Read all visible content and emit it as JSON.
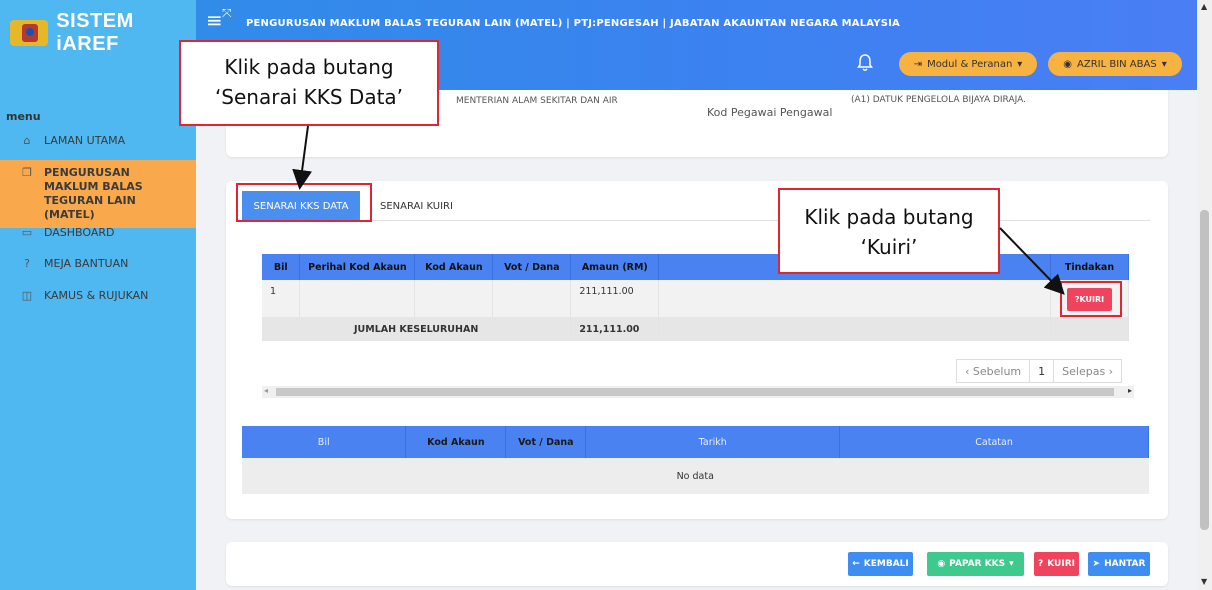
{
  "header": {
    "brand": "SISTEM iAREF",
    "page_heading": "PENGURUSAN MAKLUM BALAS TEGURAN LAIN (MATEL) | PTJ:PENGESAH | JABATAN AKAUNTAN NEGARA MALAYSIA",
    "modul_label": "Modul & Peranan",
    "user_label": "AZRIL BIN ABAS"
  },
  "sidebar": {
    "heading": "menu",
    "items": [
      {
        "label": "LAMAN UTAMA"
      },
      {
        "label": "PENGURUSAN MAKLUM BALAS TEGURAN LAIN (MATEL)"
      },
      {
        "label": "DASHBOARD"
      },
      {
        "label": "MEJA BANTUAN"
      },
      {
        "label": "KAMUS & RUJUKAN"
      }
    ]
  },
  "info": {
    "kementerian": "MENTERIAN ALAM SEKITAR DAN AIR",
    "kod_pegawai_label": "Kod Pegawai Pengawal",
    "kod_pegawai_value": "(A1) DATUK PENGELOLA BIJAYA DIRAJA."
  },
  "tabs": {
    "kks": "SENARAI KKS DATA",
    "kuiri": "SENARAI KUIRI"
  },
  "table1": {
    "headers": [
      "Bil",
      "Perihal Kod Akaun",
      "Kod Akaun",
      "Vot / Dana",
      "Amaun (RM)",
      "",
      "Tindakan"
    ],
    "row": {
      "bil": "1",
      "perihal": "",
      "kod": "",
      "vot": "",
      "amaun": "211,111.00",
      "kuiri_btn": "KUIRI"
    },
    "total_label": "JUMLAH KESELURUHAN",
    "total_value": "211,111.00"
  },
  "pager": {
    "prev": "‹ Sebelum",
    "current": "1",
    "next": "Selepas ›"
  },
  "table2": {
    "headers": [
      "Bil",
      "Kod Akaun",
      "Vot / Dana",
      "Tarikh",
      "Catatan"
    ],
    "empty": "No data"
  },
  "actions": {
    "kembali": "KEMBALI",
    "papar": "PAPAR KKS",
    "kuiri": "KUIRI",
    "hantar": "HANTAR"
  },
  "callouts": {
    "c1_line1": "Klik pada butang",
    "c1_line2": "‘Senarai KKS Data’",
    "c2_line1": "Klik pada butang",
    "c2_line2": "‘Kuiri’"
  },
  "colors": {
    "primary": "#4a82f2",
    "sidebar": "#4fb8f0",
    "active": "#f9a94b",
    "danger": "#f0445e",
    "success": "#3ec98e",
    "callout_border": "#e0262e"
  },
  "icons": [
    "hamburger-icon",
    "expand-icon",
    "bell-icon",
    "home-icon",
    "folder-icon",
    "dashboard-icon",
    "question-icon",
    "book-icon",
    "arrow-left-icon",
    "eye-icon",
    "send-icon"
  ]
}
